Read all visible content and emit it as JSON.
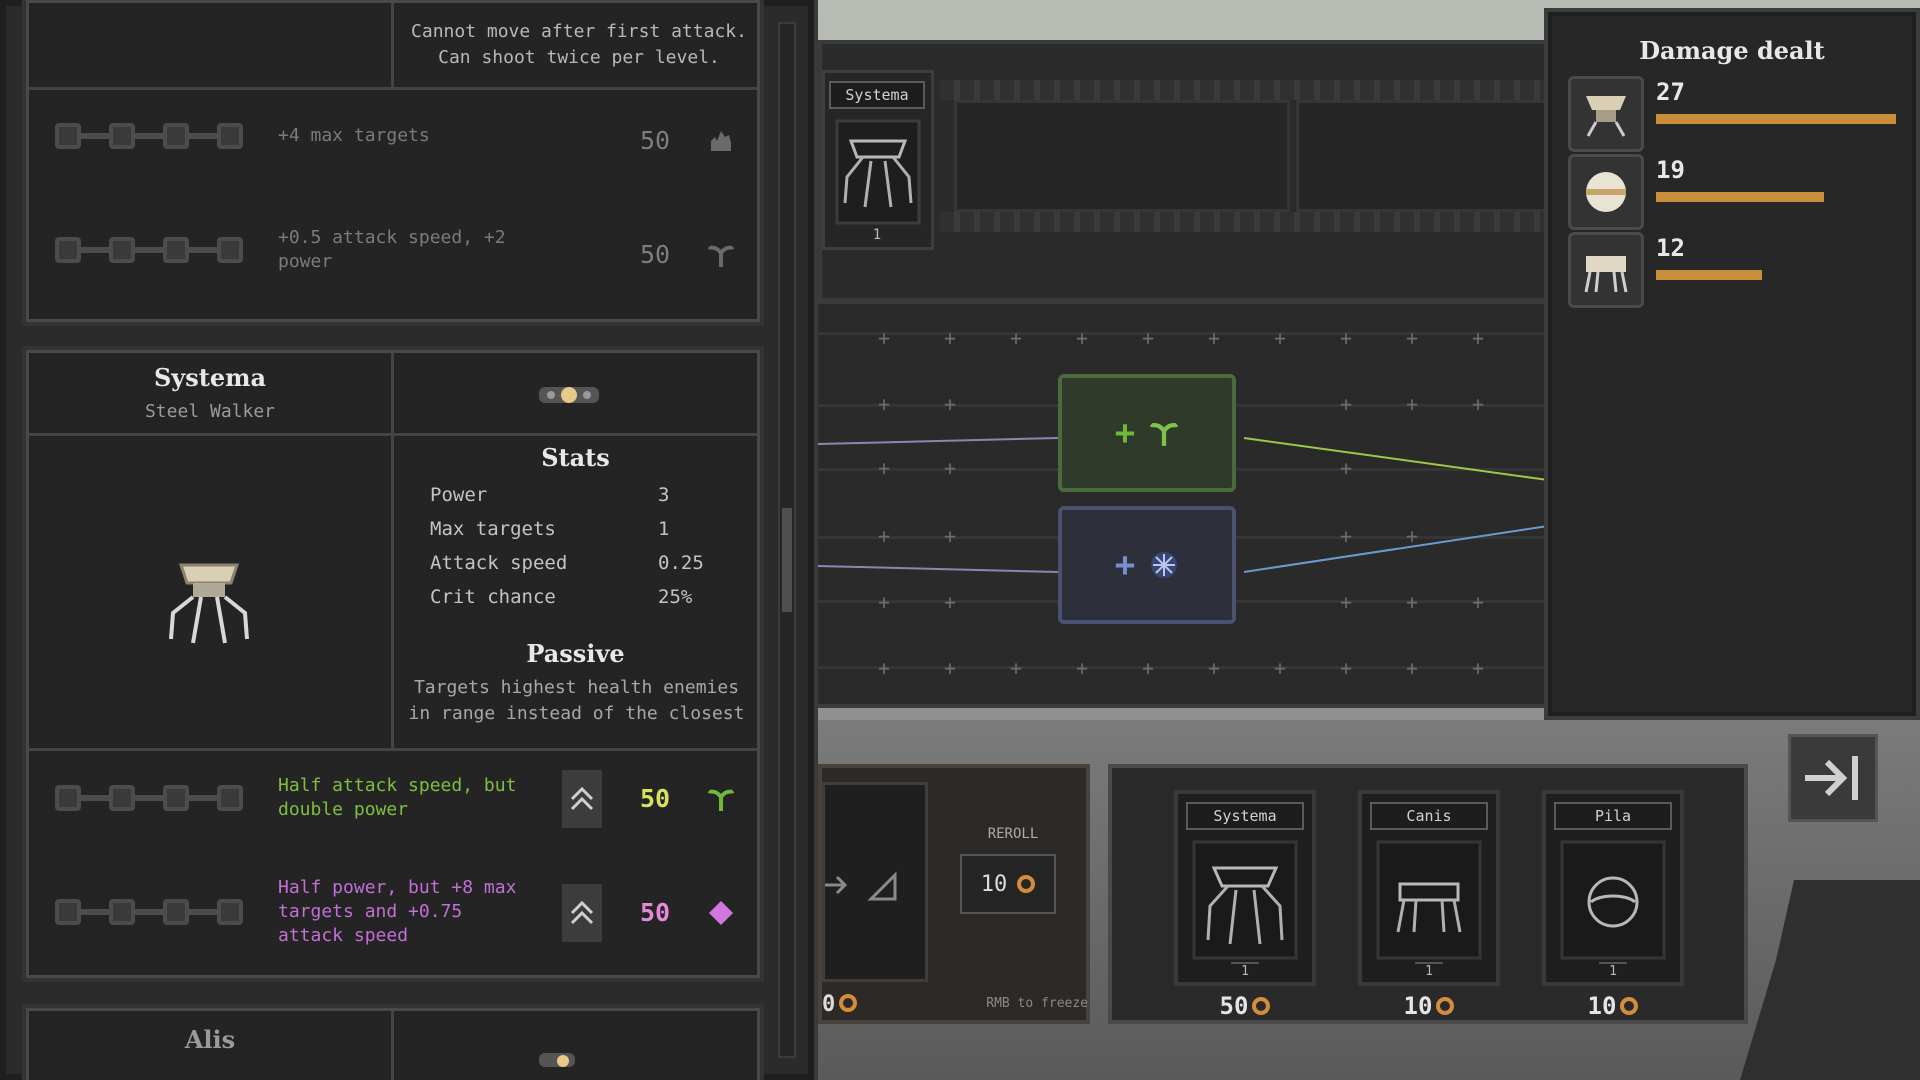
{
  "top_icons": [
    "music-icon",
    "window-icon",
    "gear-icon"
  ],
  "left_panel": {
    "prev_card": {
      "passive_tail": "Cannot move after first attack.\nCan shoot twice per level.",
      "upgrades": [
        {
          "text": "+4 max targets",
          "cost": "50",
          "icon": "flame-icon"
        },
        {
          "text": "+0.5 attack speed, +2 power",
          "cost": "50",
          "icon": "sprout-icon"
        }
      ]
    },
    "systema_card": {
      "name": "Systema",
      "subtitle": "Steel Walker",
      "stats_title": "Stats",
      "stats": [
        {
          "label": "Power",
          "value": "3"
        },
        {
          "label": "Max targets",
          "value": "1"
        },
        {
          "label": "Attack speed",
          "value": "0.25"
        },
        {
          "label": "Crit chance",
          "value": "25%"
        }
      ],
      "passive_title": "Passive",
      "passive_text": "Targets highest health enemies in range instead of the closest",
      "upgrades": [
        {
          "text": "Half attack speed, but double power",
          "cost": "50",
          "color": "#7fbf3f",
          "icon": "sprout-icon"
        },
        {
          "text": "Half power, but +8 max targets and +0.75 attack speed",
          "cost": "50",
          "color": "#c36fd6",
          "icon": "diamond-icon"
        }
      ]
    },
    "next_card": {
      "name": "Alis"
    }
  },
  "board": {
    "unit_tag": "Systema",
    "unit_level": "1"
  },
  "damage_panel": {
    "title": "Damage dealt",
    "rows": [
      {
        "value": "27",
        "fraction": 1.0
      },
      {
        "value": "19",
        "fraction": 0.7
      },
      {
        "value": "12",
        "fraction": 0.44
      }
    ]
  },
  "shop": {
    "reroll_label": "REROLL",
    "reroll_cost": "10",
    "freeze_hint": "RMB to freeze",
    "left_cost": "0",
    "cards": [
      {
        "name": "Systema",
        "level": "1",
        "price": "50"
      },
      {
        "name": "Canis",
        "level": "1",
        "price": "10"
      },
      {
        "name": "Pila",
        "level": "1",
        "price": "10"
      }
    ]
  },
  "colors": {
    "accent_orange": "#c98d3c",
    "green_node": "#4c6b3c",
    "blue_node": "#4a5270"
  }
}
